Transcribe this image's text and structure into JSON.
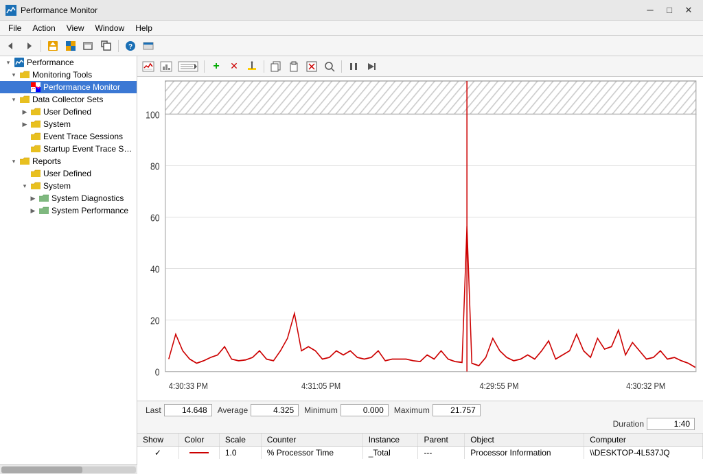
{
  "window": {
    "title": "Performance Monitor",
    "icon": "⊙"
  },
  "titlebar": {
    "minimize": "─",
    "maximize": "□",
    "close": "✕"
  },
  "menubar": {
    "items": [
      "File",
      "Action",
      "View",
      "Window",
      "Help"
    ]
  },
  "toolbar": {
    "buttons": [
      "⬅",
      "⮕",
      "📁",
      "🖥",
      "📋",
      "🖼",
      "❓",
      "📊"
    ]
  },
  "chart_toolbar": {
    "buttons": [
      {
        "name": "view-button",
        "icon": "⊞"
      },
      {
        "name": "source-button",
        "icon": "⊟"
      },
      {
        "name": "settings-button",
        "icon": "⊡"
      },
      {
        "name": "add-button",
        "icon": "+",
        "color": "#00aa00"
      },
      {
        "name": "remove-button",
        "icon": "✕",
        "color": "#cc0000"
      },
      {
        "name": "highlight-button",
        "icon": "✎"
      },
      {
        "name": "copy-button",
        "icon": "⬚"
      },
      {
        "name": "paste-button",
        "icon": "⬛"
      },
      {
        "name": "clear-button",
        "icon": "◻"
      },
      {
        "name": "zoom-button",
        "icon": "🔍"
      },
      {
        "name": "pause-button",
        "icon": "⏸"
      },
      {
        "name": "next-button",
        "icon": "⏭"
      }
    ]
  },
  "tree": {
    "root": "Performance",
    "items": [
      {
        "id": "monitoring-tools",
        "label": "Monitoring Tools",
        "level": 1,
        "expanded": true,
        "icon": "folder",
        "hasChildren": true
      },
      {
        "id": "performance-monitor",
        "label": "Performance Monitor",
        "level": 2,
        "expanded": false,
        "icon": "perf",
        "selected": true,
        "hasChildren": false
      },
      {
        "id": "data-collector-sets",
        "label": "Data Collector Sets",
        "level": 1,
        "expanded": true,
        "icon": "folder",
        "hasChildren": true
      },
      {
        "id": "user-defined-1",
        "label": "User Defined",
        "level": 2,
        "expanded": false,
        "icon": "folder",
        "hasChildren": true
      },
      {
        "id": "system-1",
        "label": "System",
        "level": 2,
        "expanded": true,
        "icon": "folder",
        "hasChildren": true
      },
      {
        "id": "event-trace",
        "label": "Event Trace Sessions",
        "level": 2,
        "expanded": false,
        "icon": "folder",
        "hasChildren": false
      },
      {
        "id": "startup-trace",
        "label": "Startup Event Trace Sess",
        "level": 2,
        "expanded": false,
        "icon": "folder",
        "hasChildren": false
      },
      {
        "id": "reports",
        "label": "Reports",
        "level": 1,
        "expanded": true,
        "icon": "folder",
        "hasChildren": true
      },
      {
        "id": "user-defined-2",
        "label": "User Defined",
        "level": 2,
        "expanded": false,
        "icon": "folder",
        "hasChildren": false
      },
      {
        "id": "system-2",
        "label": "System",
        "level": 2,
        "expanded": true,
        "icon": "folder",
        "hasChildren": true
      },
      {
        "id": "system-diagnostics",
        "label": "System Diagnostics",
        "level": 3,
        "expanded": false,
        "icon": "folder-open",
        "hasChildren": true
      },
      {
        "id": "system-performance",
        "label": "System Performance",
        "level": 3,
        "expanded": false,
        "icon": "folder-open",
        "hasChildren": true
      }
    ]
  },
  "stats": {
    "last_label": "Last",
    "last_value": "14.648",
    "average_label": "Average",
    "average_value": "4.325",
    "minimum_label": "Minimum",
    "minimum_value": "0.000",
    "maximum_label": "Maximum",
    "maximum_value": "21.757",
    "duration_label": "Duration",
    "duration_value": "1:40"
  },
  "chart": {
    "y_max": "100",
    "y_labels": [
      "100",
      "80",
      "60",
      "40",
      "20",
      "0"
    ],
    "x_labels": [
      "4:30:33 PM",
      "4:31:05 PM",
      "4:29:55 PM",
      "4:30:32 PM"
    ],
    "accent_color": "#cc0000",
    "grid_color": "#e0e0e0"
  },
  "counter_table": {
    "headers": [
      "Show",
      "Color",
      "Scale",
      "Counter",
      "Instance",
      "Parent",
      "Object",
      "Computer"
    ],
    "rows": [
      {
        "show": "✓",
        "color": "red-line",
        "scale": "1.0",
        "counter": "% Processor Time",
        "instance": "_Total",
        "parent": "---",
        "object": "Processor Information",
        "computer": "\\\\DESKTOP-4L537JQ"
      }
    ]
  }
}
